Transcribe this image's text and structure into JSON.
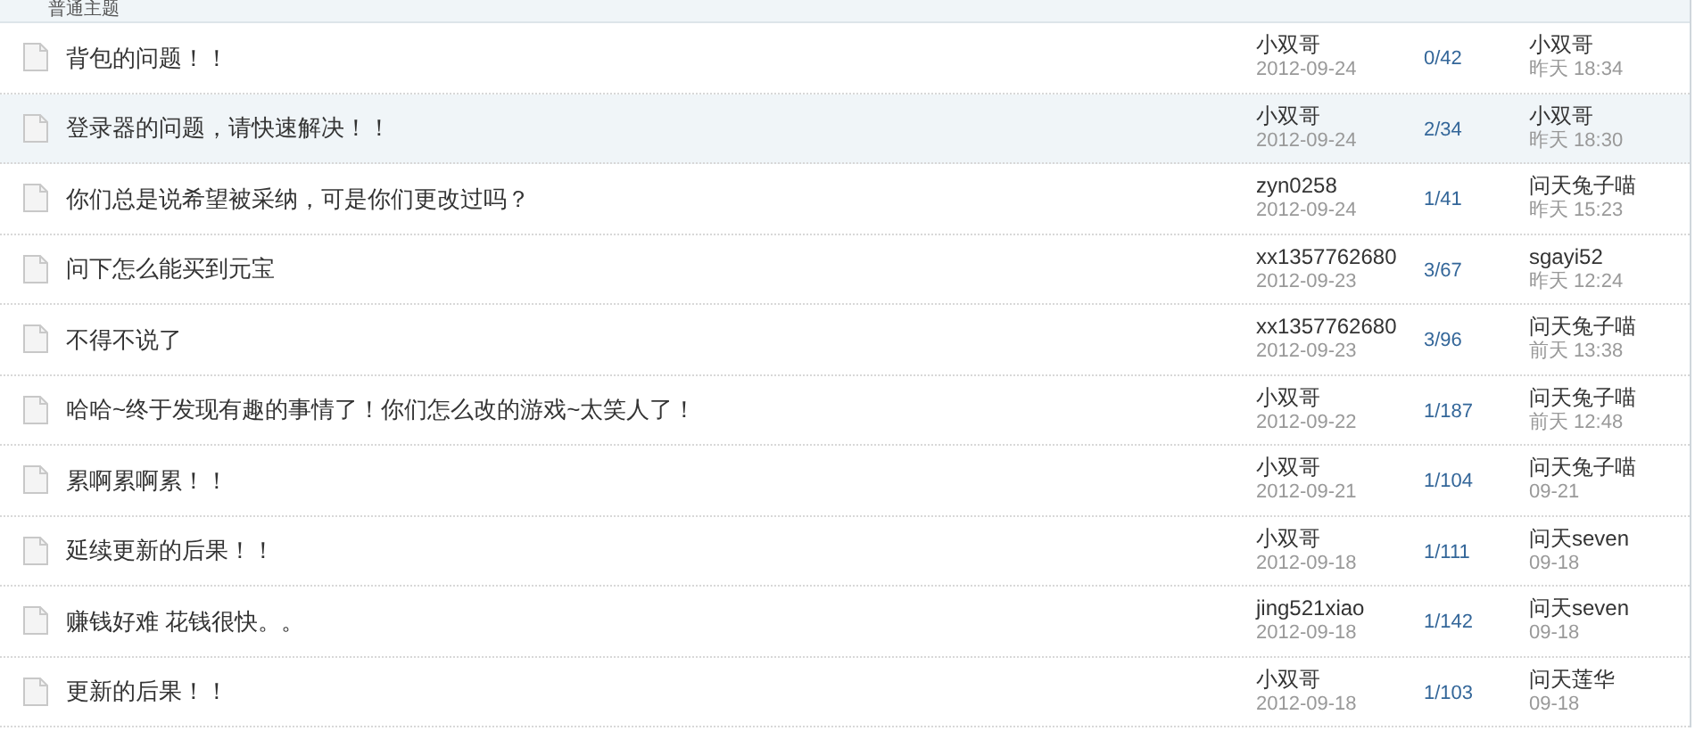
{
  "header": {
    "title": "普通主题"
  },
  "rows": [
    {
      "title": "背包的问题！！",
      "author": "小双哥",
      "date": "2012-09-24",
      "count": "0/42",
      "last_user": "小双哥",
      "last_time": "昨天 18:34",
      "selected": false
    },
    {
      "title": "登录器的问题，请快速解决！！",
      "author": "小双哥",
      "date": "2012-09-24",
      "count": "2/34",
      "last_user": "小双哥",
      "last_time": "昨天 18:30",
      "selected": true
    },
    {
      "title": "你们总是说希望被采纳，可是你们更改过吗？",
      "author": "zyn0258",
      "date": "2012-09-24",
      "count": "1/41",
      "last_user": "问天兔子喵",
      "last_time": "昨天 15:23",
      "selected": false
    },
    {
      "title": "问下怎么能买到元宝",
      "author": "xx1357762680",
      "date": "2012-09-23",
      "count": "3/67",
      "last_user": "sgayi52",
      "last_time": "昨天 12:24",
      "selected": false
    },
    {
      "title": "不得不说了",
      "author": "xx1357762680",
      "date": "2012-09-23",
      "count": "3/96",
      "last_user": "问天兔子喵",
      "last_time": "前天 13:38",
      "selected": false
    },
    {
      "title": "哈哈~终于发现有趣的事情了！你们怎么改的游戏~太笑人了！",
      "author": "小双哥",
      "date": "2012-09-22",
      "count": "1/187",
      "last_user": "问天兔子喵",
      "last_time": "前天 12:48",
      "selected": false
    },
    {
      "title": "累啊累啊累！！",
      "author": "小双哥",
      "date": "2012-09-21",
      "count": "1/104",
      "last_user": "问天兔子喵",
      "last_time": "09-21",
      "selected": false
    },
    {
      "title": "延续更新的后果！！",
      "author": "小双哥",
      "date": "2012-09-18",
      "count": "1/111",
      "last_user": "问天seven",
      "last_time": "09-18",
      "selected": false
    },
    {
      "title": "赚钱好难 花钱很快。。",
      "author": "jing521xiao",
      "date": "2012-09-18",
      "count": "1/142",
      "last_user": "问天seven",
      "last_time": "09-18",
      "selected": false
    },
    {
      "title": "更新的后果！！",
      "author": "小双哥",
      "date": "2012-09-18",
      "count": "1/103",
      "last_user": "问天莲华",
      "last_time": "09-18",
      "selected": false
    }
  ]
}
